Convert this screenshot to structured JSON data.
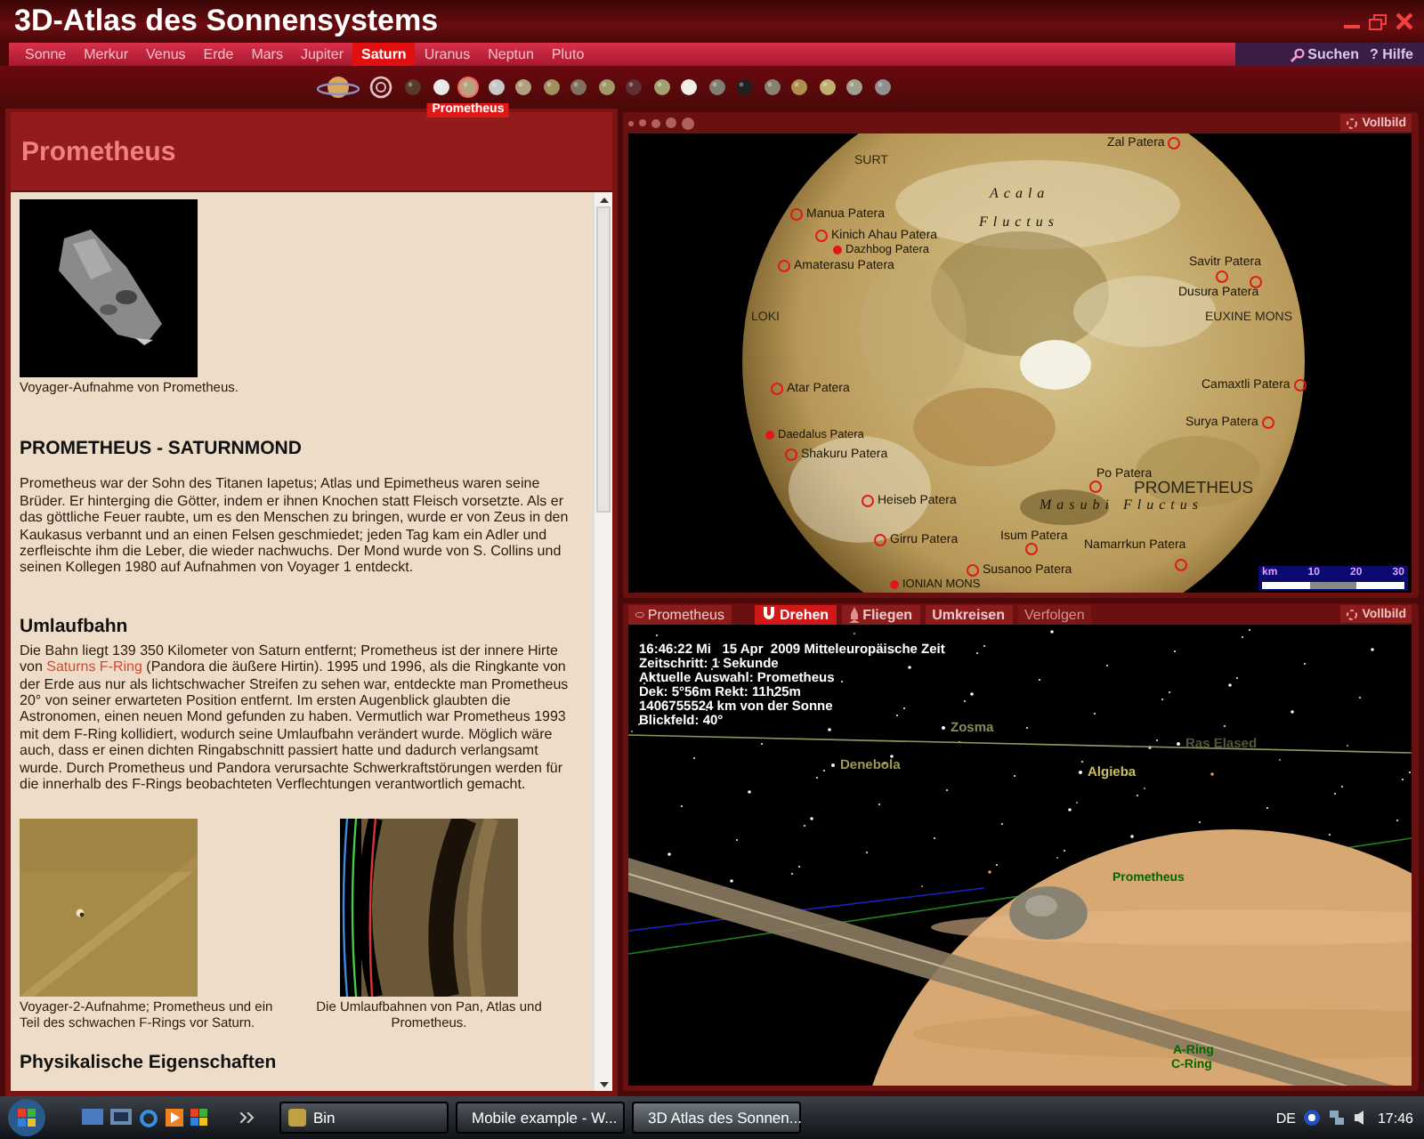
{
  "window": {
    "title": "3D-Atlas des Sonnensystems"
  },
  "planet_tabs": [
    {
      "label": "Sonne",
      "selected": false
    },
    {
      "label": "Merkur",
      "selected": false
    },
    {
      "label": "Venus",
      "selected": false
    },
    {
      "label": "Erde",
      "selected": false
    },
    {
      "label": "Mars",
      "selected": false
    },
    {
      "label": "Jupiter",
      "selected": false
    },
    {
      "label": "Saturn",
      "selected": true
    },
    {
      "label": "Uranus",
      "selected": false
    },
    {
      "label": "Neptun",
      "selected": false
    },
    {
      "label": "Pluto",
      "selected": false
    }
  ],
  "search_button": {
    "label": "Suchen"
  },
  "help_button": {
    "icon": "?",
    "label": "Hilfe"
  },
  "moon_bar": {
    "tooltip": "Prometheus",
    "moons": [
      {
        "color": "#5a3a2a",
        "selected": false
      },
      {
        "color": "#e8e8e8",
        "selected": false
      },
      {
        "color": "#b8a080",
        "selected": true
      },
      {
        "color": "#c8c8c8",
        "selected": false
      },
      {
        "color": "#b0a080",
        "selected": false
      },
      {
        "color": "#a09060",
        "selected": false
      },
      {
        "color": "#807060",
        "selected": false
      },
      {
        "color": "#a09868",
        "selected": false
      },
      {
        "color": "#603030",
        "selected": false
      },
      {
        "color": "#a0a070",
        "selected": false
      },
      {
        "color": "#eeeee6",
        "selected": false
      },
      {
        "color": "#808070",
        "selected": false
      },
      {
        "color": "#202020",
        "selected": false
      },
      {
        "color": "#888070",
        "selected": false
      },
      {
        "color": "#b09050",
        "selected": false
      },
      {
        "color": "#c0b070",
        "selected": false
      },
      {
        "color": "#a0a090",
        "selected": false
      },
      {
        "color": "#909090",
        "selected": false
      }
    ]
  },
  "info_panel": {
    "title": "Prometheus",
    "image_caption": "Voyager-Aufnahme von Prometheus.",
    "heading": "PROMETHEUS - SATURNMOND",
    "intro": "Prometheus war der Sohn des Titanen Iapetus; Atlas und Epimetheus waren seine Brüder. Er hinterging die Götter, indem er ihnen Knochen statt Fleisch vorsetzte. Als er das göttliche Feuer raubte, um es den Menschen zu bringen, wurde er von Zeus in den Kaukasus verbannt und an einen Felsen geschmiedet; jeden Tag kam ein Adler und zerfleischte ihm die Leber, die wieder nachwuchs. Der Mond wurde von S. Collins und seinen Kollegen 1980 auf Aufnahmen von Voyager 1 entdeckt.",
    "orbit_heading": "Umlaufbahn",
    "orbit_text": {
      "before": "Die Bahn liegt 139 350 Kilometer von Saturn entfernt; Prometheus ist der innere Hirte von",
      "link": "Saturns F-Ring",
      "after": "(Pandora die äußere Hirtin). 1995 und 1996, als die Ringkante von der Erde aus nur als lichtschwacher Streifen zu sehen war, entdeckte man Prometheus 20° von seiner erwarteten Position entfernt. Im ersten Augenblick glaubten die Astronomen, einen neuen Mond gefunden zu haben. Vermutlich war Prometheus 1993 mit dem F-Ring kollidiert, wodurch seine Umlaufbahn verändert wurde. Möglich wäre auch, dass er einen dichten Ringabschnitt passiert hatte und dadurch verlangsamt wurde. Durch Prometheus und Pandora verursachte Schwerkraftstörungen werden für die innerhalb des F-Rings beobachteten Verflechtungen verantwortlich gemacht."
    },
    "figures": [
      {
        "kind": "moon_closeup",
        "caption": "Voyager-2-Aufnahme; Prometheus und ein Teil des schwachen F-Rings vor Saturn."
      },
      {
        "kind": "rings",
        "caption": "Die Umlaufbahnen von Pan, Atlas und Prometheus."
      }
    ],
    "next_heading": "Physikalische Eigenschaften"
  },
  "surface_view": {
    "fullscreen": "Vollbild",
    "labels": [
      {
        "text": "Zal Patera",
        "kind": "marker_after"
      },
      {
        "text": "SURT",
        "kind": "feature"
      },
      {
        "text": "Acala",
        "kind": "region"
      },
      {
        "text": "Fluctus",
        "kind": "region"
      },
      {
        "text": "Manua Patera",
        "kind": "marker_before"
      },
      {
        "text": "Kinich Ahau Patera",
        "kind": "marker_before"
      },
      {
        "text": "Dazhbog Patera",
        "kind": "minor"
      },
      {
        "text": "Amaterasu Patera",
        "kind": "marker_before"
      },
      {
        "text": "Savitr Patera",
        "kind": "plain"
      },
      {
        "text": "Dusura Patera",
        "kind": "plain"
      },
      {
        "text": "EUXINE MONS",
        "kind": "feature"
      },
      {
        "text": "LOKI",
        "kind": "feature"
      },
      {
        "text": "Atar Patera",
        "kind": "marker_before"
      },
      {
        "text": "Camaxtli Patera",
        "kind": "marker_after"
      },
      {
        "text": "Daedalus Patera",
        "kind": "minor"
      },
      {
        "text": "Surya Patera",
        "kind": "marker_after"
      },
      {
        "text": "Shakuru Patera",
        "kind": "marker_before"
      },
      {
        "text": "Po Patera",
        "kind": "plain"
      },
      {
        "text": "PROMETHEUS",
        "kind": "major"
      },
      {
        "text": "Heiseb Patera",
        "kind": "marker_before"
      },
      {
        "text": "Masubi Fluctus",
        "kind": "region"
      },
      {
        "text": "Girru Patera",
        "kind": "marker_before"
      },
      {
        "text": "Isum Patera",
        "kind": "plain"
      },
      {
        "text": "Namarrkun Patera",
        "kind": "plain"
      },
      {
        "text": "Susanoo Patera",
        "kind": "marker_before"
      },
      {
        "text": "IONIAN MONS",
        "kind": "minor"
      }
    ],
    "scale": {
      "unit": "km",
      "ticks": [
        "10",
        "20",
        "30"
      ]
    }
  },
  "space_view": {
    "target": "Prometheus",
    "fullscreen": "Vollbild",
    "modes": [
      {
        "label": "Drehen",
        "kind": "rotate",
        "selected": true,
        "disabled": false
      },
      {
        "label": "Fliegen",
        "kind": "fly",
        "selected": false,
        "disabled": false
      },
      {
        "label": "Umkreisen",
        "kind": "orbit",
        "selected": false,
        "disabled": false
      },
      {
        "label": "Verfolgen",
        "kind": "follow",
        "selected": false,
        "disabled": true
      }
    ],
    "info_lines": [
      "16:46:22 Mi   15 Apr  2009 Mitteleuropäische Zeit",
      "Zeitschritt: 1 Sekunde",
      "Aktuelle Auswahl: Prometheus",
      "Dek: 5°56m Rekt: 11h25m",
      "1406755524 km von der Sonne",
      "Blickfeld: 40°"
    ],
    "star_labels": [
      {
        "text": "Zosma",
        "color": "#8a8a50"
      },
      {
        "text": "Denebola",
        "color": "#9a9a50"
      },
      {
        "text": "Algieba",
        "color": "#c8c060"
      },
      {
        "text": "Ras Elased",
        "color": "#55553a"
      }
    ],
    "body_labels": [
      "Prometheus",
      "A-Ring",
      "C-Ring"
    ]
  },
  "taskbar": {
    "tasks": [
      {
        "label": "Bin",
        "selected": false
      },
      {
        "label": "Mobile example - W...",
        "selected": false
      },
      {
        "label": "3D Atlas des Sonnen...",
        "selected": true
      }
    ],
    "language": "DE",
    "clock": "17:46"
  }
}
